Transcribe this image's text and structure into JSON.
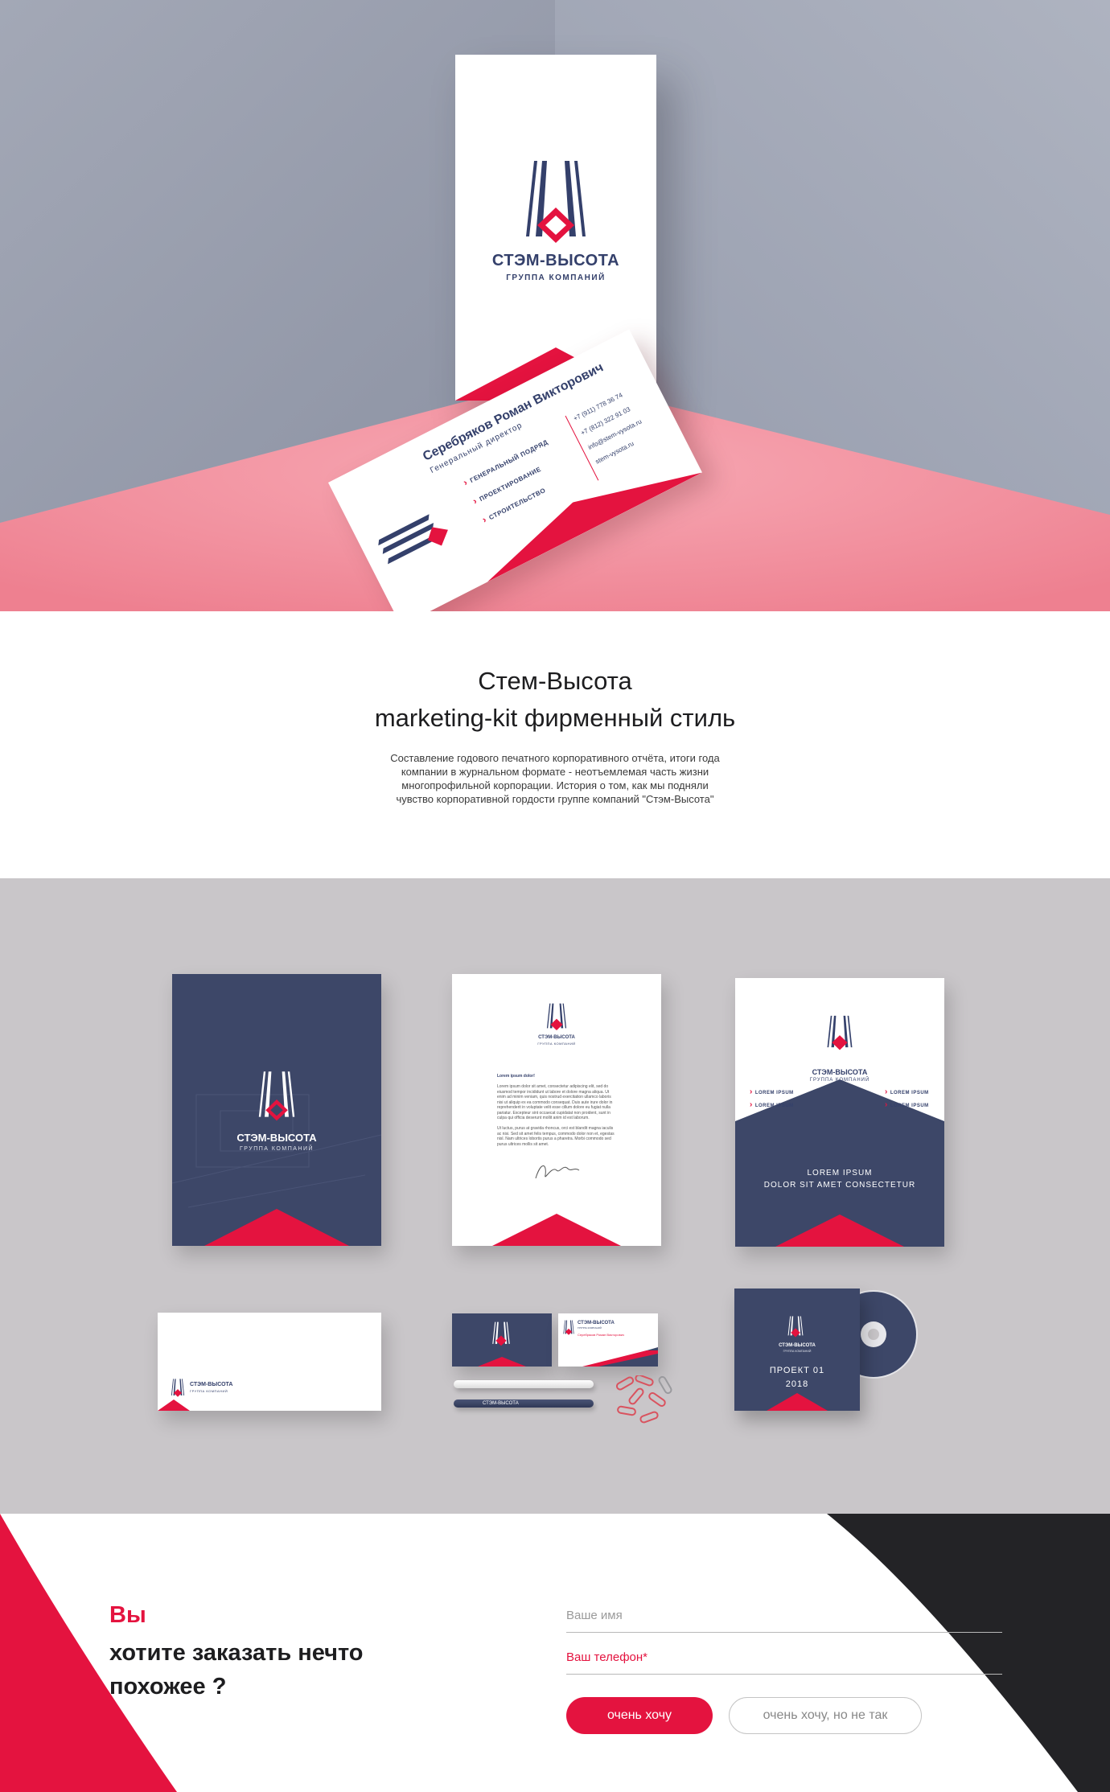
{
  "hero": {
    "tent": {
      "brand": "СТЭМ-ВЫСОТА",
      "subtitle": "ГРУППА КОМПАНИЙ"
    },
    "card": {
      "name": "Серебряков Роман Викторович",
      "position": "Генеральный директор",
      "services": [
        "ГЕНЕРАЛЬНЫЙ ПОДРЯД",
        "ПРОЕКТИРОВАНИЕ",
        "СТРОИТЕЛЬСТВО"
      ],
      "contacts": [
        "+7 (911) 778 36 74",
        "+7 (812) 322 91 03",
        "info@stem-vysota.ru",
        "stem-vysota.ru"
      ]
    }
  },
  "intro": {
    "title_line1": "Стем-Высота",
    "title_line2": "marketing-kit фирменный стиль",
    "description": "Составление годового печатного корпоративного отчёта, итоги года компании в журнальном формате - неотъемлемая часть жизни многопрофильной корпорации. История о том, как мы подняли чувство корпоративной гордости группе компаний \"Стэм-Высота\""
  },
  "mockup": {
    "folder": {
      "brand": "СТЭМ-ВЫСОТА",
      "subtitle": "ГРУППА КОМПАНИЙ"
    },
    "letter": {
      "brand": "СТЭМ-ВЫСОТА",
      "subtitle": "ГРУППА КОМПАНИЙ",
      "heading": "Lorem ipsum dolor!",
      "para1": "Lorem ipsum dolor sit amet, consectetur adipiscing elit, sed do eiusmod tempor incididunt ut labore et dolore magna aliqua. Ut enim ad minim veniam, quis nostrud exercitation ullamco laboris nisi ut aliquip ex ea commodo consequat. Duis aute irure dolor in reprehenderit in voluptate velit esse cillum dolore eu fugiat nulla pariatur. Excepteur sint occaecat cupidatat non proident, sunt in culpa qui officia deserunt mollit anim id est laborum.",
      "para2": "Ut luctus, purus at gravida rhoncus, orci est blandit magna iaculis ac nisi. Sed sit amet felis tempus, commodo dolor non et, egestas nisl. Nam ultrices lobortis purus a pharetra. Morbi commodo sed purus ultrices mollis sit amet."
    },
    "book": {
      "brand": "СТЭМ-ВЫСОТА",
      "subtitle": "ГРУППА КОМПАНИЙ",
      "items": [
        "LOREM IPSUM",
        "LOREM IPSUM",
        "LOREM IPSUM",
        "LOREM IPSUM"
      ],
      "text1": "LOREM IPSUM",
      "text2": "DOLOR SIT AMET CONSECTETUR"
    },
    "envelope": {
      "brand": "СТЭМ-ВЫСОТА",
      "subtitle": "ГРУППА КОМПАНИЙ"
    },
    "card_back": {
      "brand": "СТЭМ-ВЫСОТА",
      "subtitle": "ГРУППА КОМПАНИЙ",
      "name": "Серебряков Роман Викторович"
    },
    "pen": {
      "brand": "СТЭМ-ВЫСОТА"
    },
    "cd": {
      "brand": "СТЭМ-ВЫСОТА",
      "subtitle": "ГРУППА КОМПАНИЙ",
      "project": "ПРОЕКТ 01",
      "year": "2018",
      "disc_label": "ПРОЕКТ 01 2018"
    }
  },
  "form": {
    "question_accent": "Вы",
    "question_rest": "хотите заказать нечто похожее ?",
    "name_placeholder": "Ваше имя",
    "phone_placeholder": "Ваш телефон*",
    "submit_label": "очень хочу",
    "alt_label": "очень хочу, но не так"
  },
  "colors": {
    "red": "#e4133f",
    "navy": "#3d4768",
    "brand_text": "#34406b",
    "hero_wall": "#9aa1b1",
    "hero_floor": "#f28c9a",
    "mockup_bg": "#c9c6c9",
    "dark": "#232326"
  }
}
